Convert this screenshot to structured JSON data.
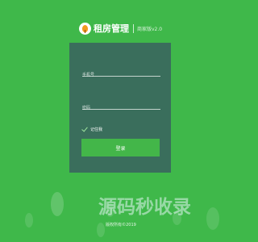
{
  "brand": {
    "name": "租房管理",
    "version": "商家版v2.0"
  },
  "login": {
    "phone_placeholder": "手机号",
    "password_placeholder": "密码",
    "remember_label": "记住我",
    "remember_checked": true,
    "submit_label": "登录"
  },
  "footer": {
    "copyright": "版权所有©2019"
  },
  "watermark": {
    "text": "源码秒收录"
  },
  "colors": {
    "background": "#3fb84a",
    "panel": "#3a6e5c",
    "button": "#43b649"
  }
}
